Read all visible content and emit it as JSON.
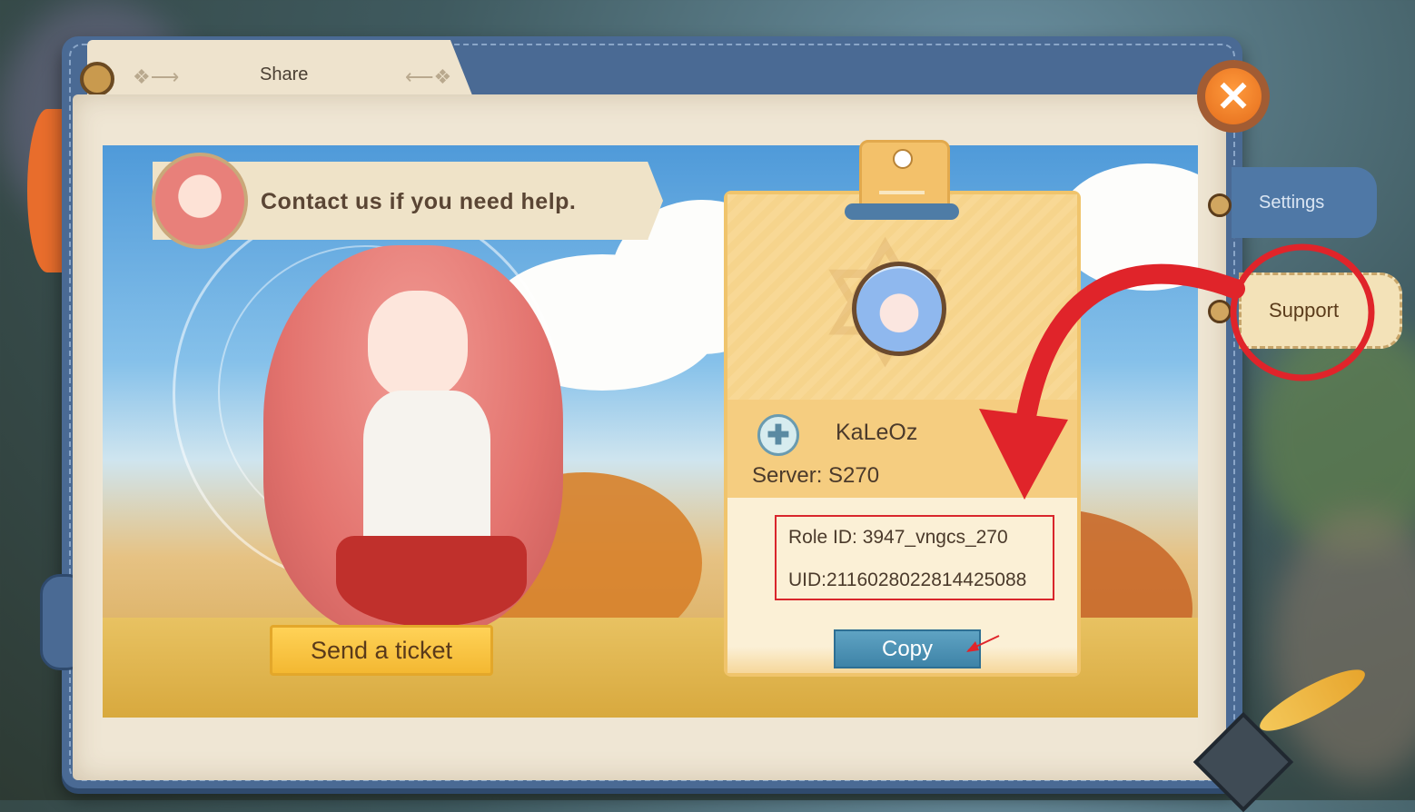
{
  "header": {
    "tab_label": "Share"
  },
  "banner": {
    "message": "Contact us if you need help."
  },
  "actions": {
    "send_ticket_label": "Send a ticket",
    "copy_label": "Copy",
    "close_icon": "close-icon"
  },
  "player_card": {
    "name": "KaLeOz",
    "server": "Server: S270",
    "role_id": "Role ID: 3947_vngcs_270",
    "uid": "UID:2116028022814425088",
    "class_icon": "medic-cross-icon"
  },
  "side_tabs": [
    {
      "label": "Settings",
      "active": false
    },
    {
      "label": "Support",
      "active": true
    }
  ],
  "colors": {
    "annotation_red": "#e0242a",
    "accent_gold": "#f3b832",
    "copy_blue": "#3e83a7",
    "book_blue": "#4a6a94"
  }
}
